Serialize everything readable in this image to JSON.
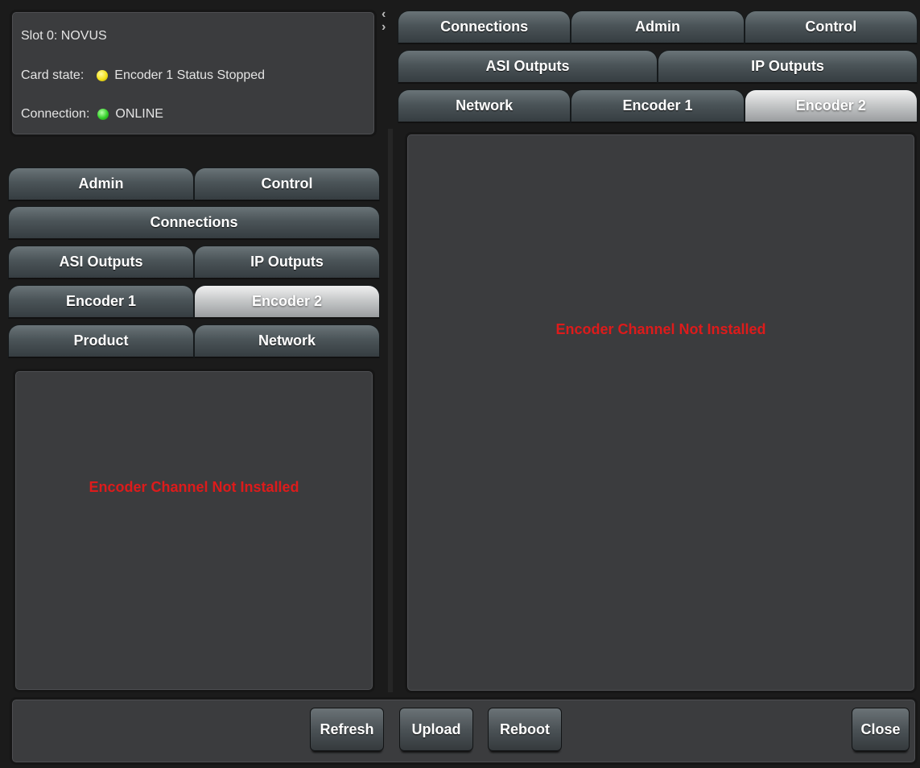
{
  "status": {
    "slot_label": "Slot 0: NOVUS",
    "card_state_label": "Card state:",
    "card_state_value": "Encoder 1 Status Stopped",
    "card_state_color": "#f4e21c",
    "connection_label": "Connection:",
    "connection_value": "ONLINE",
    "connection_color": "#34d12a"
  },
  "left_tabs": {
    "admin": "Admin",
    "control": "Control",
    "connections": "Connections",
    "asi_outputs": "ASI Outputs",
    "ip_outputs": "IP Outputs",
    "encoder1": "Encoder 1",
    "encoder2": "Encoder 2",
    "product": "Product",
    "network": "Network",
    "active": "Encoder 2"
  },
  "right_tabs": {
    "connections": "Connections",
    "admin": "Admin",
    "control": "Control",
    "asi_outputs": "ASI Outputs",
    "ip_outputs": "IP Outputs",
    "network": "Network",
    "encoder1": "Encoder 1",
    "encoder2": "Encoder 2",
    "active": "Encoder 2"
  },
  "left_content": {
    "message": "Encoder Channel Not Installed"
  },
  "right_content": {
    "message": "Encoder Channel Not Installed"
  },
  "collapse_icon": "chevron-left-right-icon",
  "buttons": {
    "refresh": "Refresh",
    "upload": "Upload",
    "reboot": "Reboot",
    "close": "Close"
  },
  "colors": {
    "error_text": "#dd1b1b",
    "panel_bg": "#3b3c3e"
  }
}
